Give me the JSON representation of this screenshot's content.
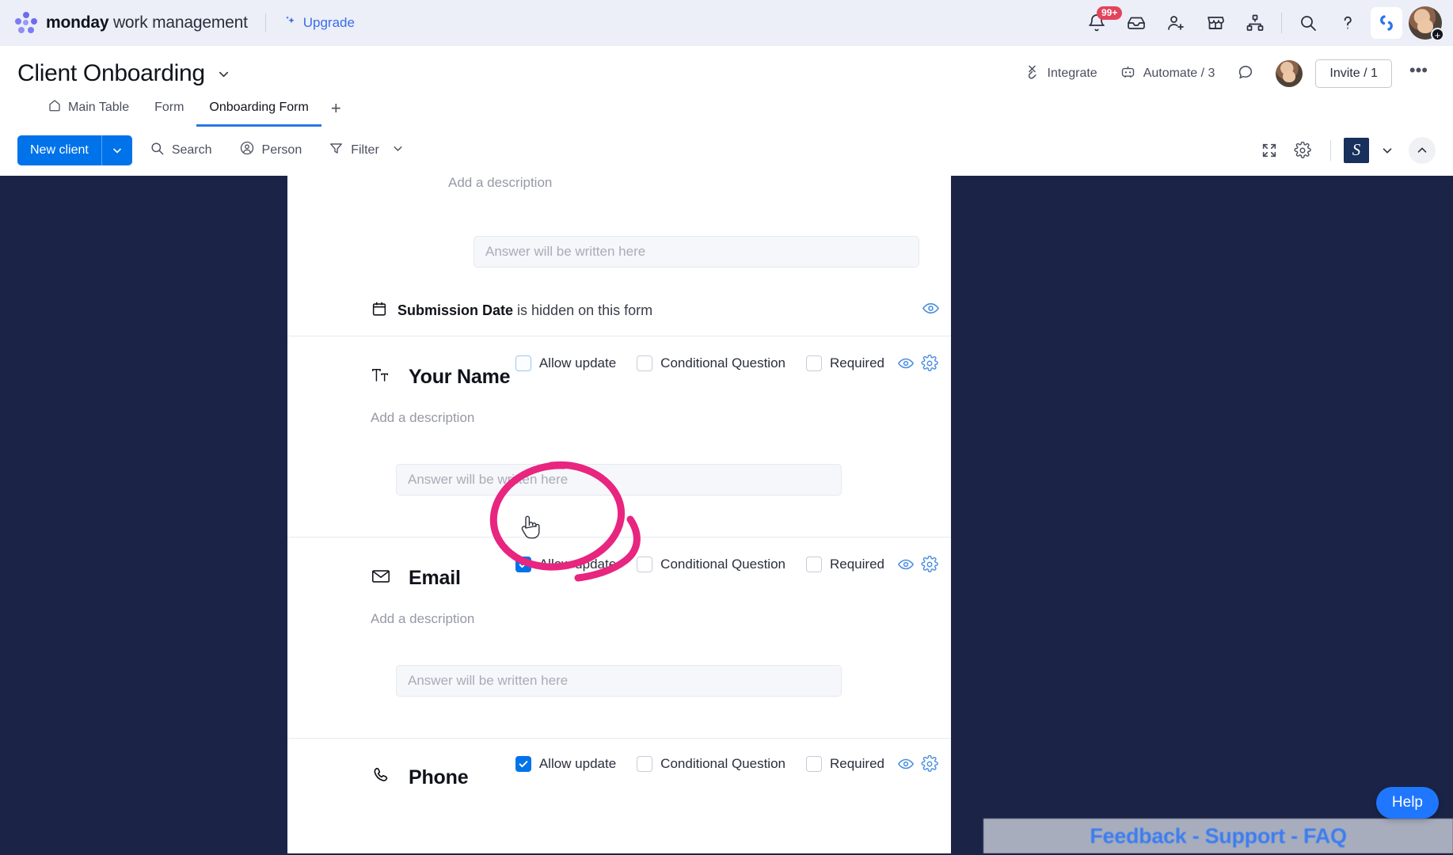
{
  "topbar": {
    "brand_bold": "monday",
    "brand_rest": " work management",
    "upgrade_label": "Upgrade",
    "notification_badge": "99+",
    "icons": [
      {
        "name": "bell-icon",
        "label": "Notifications"
      },
      {
        "name": "inbox-icon",
        "label": "Inbox"
      },
      {
        "name": "invite-person-icon",
        "label": "Invite members"
      },
      {
        "name": "marketplace-icon",
        "label": "Marketplace"
      },
      {
        "name": "workflow-icon",
        "label": "Workflows"
      },
      {
        "name": "search-icon",
        "label": "Search"
      },
      {
        "name": "help-icon",
        "label": "Help"
      }
    ],
    "product_logo_letter": "S",
    "avatar_plus": "+"
  },
  "board": {
    "title": "Client Onboarding",
    "tabs": [
      {
        "label": "Main Table",
        "icon": "home-icon",
        "active": false
      },
      {
        "label": "Form",
        "icon": "",
        "active": false
      },
      {
        "label": "Onboarding Form",
        "icon": "",
        "active": true
      }
    ],
    "add_tab": "+",
    "integrate_label": "Integrate",
    "automate_label": "Automate / 3",
    "invite_label": "Invite / 1",
    "more_label": "•••"
  },
  "toolbar": {
    "new_item_label": "New client",
    "search_label": "Search",
    "person_label": "Person",
    "filter_label": "Filter",
    "expand_icon": "expand-icon",
    "settings_icon": "gear-icon",
    "app_logo_letter": "S"
  },
  "form": {
    "top_cut_description": "Add a description",
    "answer_placeholder": "Answer will be written here",
    "hidden_notice": {
      "field": "Submission Date",
      "suffix": " is hidden on this form",
      "icon": "calendar-icon"
    },
    "option_labels": {
      "allow_update": "Allow update",
      "conditional_question": "Conditional Question",
      "required": "Required"
    },
    "description_placeholder": "Add a description",
    "questions": [
      {
        "title": "Your Name",
        "icon": "text-type-icon",
        "allow_update": false,
        "allow_update_hover": true,
        "conditional_question": false,
        "required": false,
        "description": "Add a description",
        "answer_placeholder": "Answer will be written here"
      },
      {
        "title": "Email",
        "icon": "envelope-icon",
        "allow_update": true,
        "allow_update_hover": false,
        "conditional_question": false,
        "required": false,
        "description": "Add a description",
        "answer_placeholder": "Answer will be written here"
      },
      {
        "title": "Phone",
        "icon": "phone-icon",
        "allow_update": true,
        "allow_update_hover": false,
        "conditional_question": false,
        "required": false,
        "description": "",
        "answer_placeholder": ""
      }
    ]
  },
  "footer": {
    "feedback_bar": "Feedback - Support - FAQ",
    "help_label": "Help"
  },
  "colors": {
    "brand_blue": "#0073ea",
    "accent_pink": "#e8257f",
    "dark_navy": "#1b2447",
    "topbar_bg": "#eceff8",
    "icon_blue": "#4b8fe0"
  }
}
